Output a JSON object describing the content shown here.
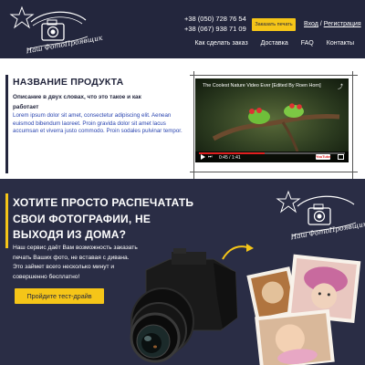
{
  "header": {
    "phones": [
      "+38 (050) 728 76 54",
      "+38 (067) 938 71 09"
    ],
    "order_label": "Заказать печать",
    "login_label": "Вход",
    "separator": "/",
    "register_label": "Регистрация",
    "logo_text": "Наш ФотоПроявщик",
    "nav": [
      "Как сделать заказ",
      "Доставка",
      "FAQ",
      "Контакты"
    ]
  },
  "product": {
    "title": "НАЗВАНИЕ ПРОДУКТА",
    "subtitle": "Описание в двух словах, что это такое и как работает",
    "body": "Lorem ipsum dolor sit amet, consectetur adipiscing elit. Aenean euismod bibendum laoreet. Proin gravida dolor sit amet lacus accumsan et viverra justo commodo. Proin sodales pulvinar tempor.",
    "video": {
      "title": "The Coolest Nature Video Ever [Edited By Roen Horn]",
      "time": "0:45 / 1:41",
      "progress": 0.45,
      "brand": "YouTube"
    }
  },
  "promo": {
    "title": "ХОТИТЕ ПРОСТО РАСПЕЧАТАТЬ СВОИ ФОТОГРАФИИ, НЕ ВЫХОДЯ ИЗ ДОМА?",
    "text": "Наш сервис даёт Вам возможность заказать печать Ваших фото, не вставая с дивана. Это займет всего несколько минут и совершенно бесплатно!",
    "button_label": "Пройдите тест-драйв",
    "logo_text": "Наш ФотоПроявщик"
  },
  "colors": {
    "navy": "#23263d",
    "promo_bg": "#2a2d45",
    "accent": "#f5c518",
    "body_text": "#2a45b0"
  }
}
